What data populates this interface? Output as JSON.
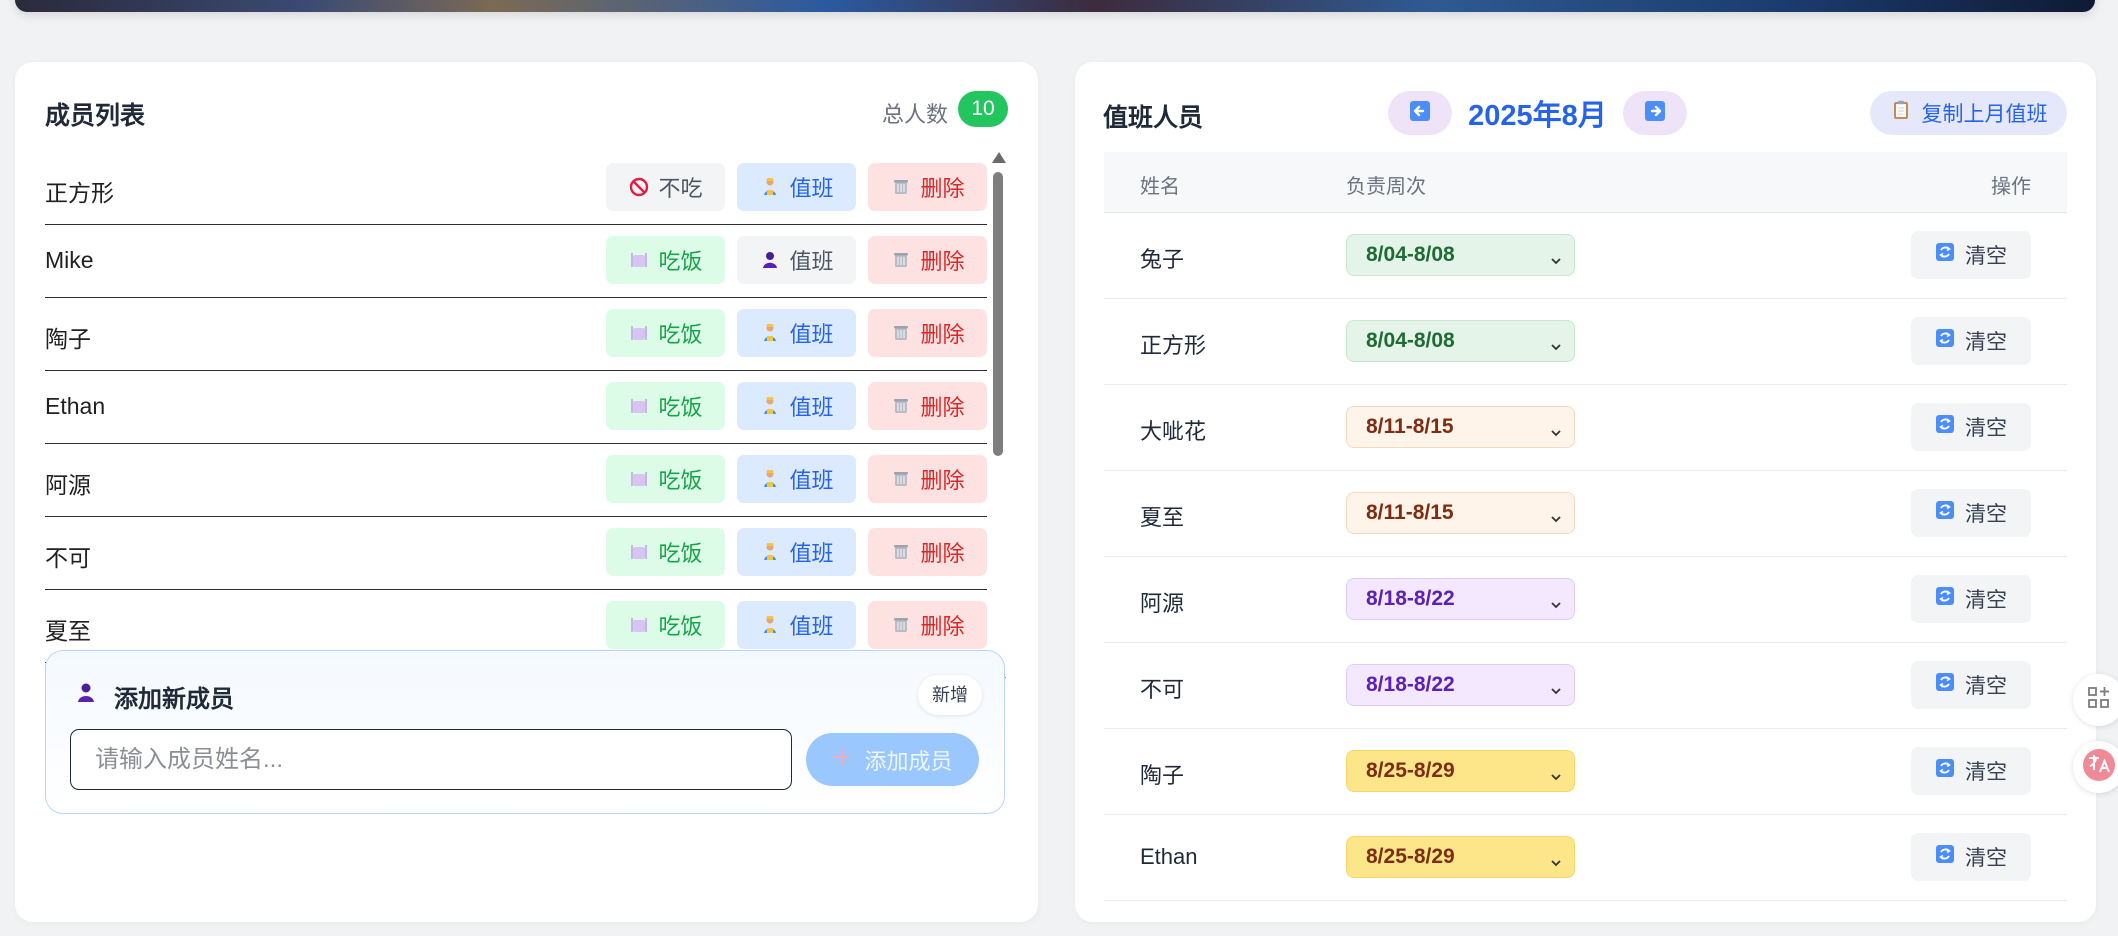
{
  "left_panel": {
    "title": "成员列表",
    "total_label": "总人数",
    "total_count": "10",
    "members": [
      {
        "name": "正方形",
        "eat_label": "不吃",
        "eat_state": "no",
        "duty_label": "值班",
        "duty_state": "active",
        "delete_label": "删除"
      },
      {
        "name": "Mike",
        "eat_label": "吃饭",
        "eat_state": "yes",
        "duty_label": "值班",
        "duty_state": "neutral",
        "delete_label": "删除"
      },
      {
        "name": "陶子",
        "eat_label": "吃饭",
        "eat_state": "yes",
        "duty_label": "值班",
        "duty_state": "active",
        "delete_label": "删除"
      },
      {
        "name": "Ethan",
        "eat_label": "吃饭",
        "eat_state": "yes",
        "duty_label": "值班",
        "duty_state": "active",
        "delete_label": "删除"
      },
      {
        "name": "阿源",
        "eat_label": "吃饭",
        "eat_state": "yes",
        "duty_label": "值班",
        "duty_state": "active",
        "delete_label": "删除"
      },
      {
        "name": "不可",
        "eat_label": "吃饭",
        "eat_state": "yes",
        "duty_label": "值班",
        "duty_state": "active",
        "delete_label": "删除"
      },
      {
        "name": "夏至",
        "eat_label": "吃饭",
        "eat_state": "yes",
        "duty_label": "值班",
        "duty_state": "active",
        "delete_label": "删除"
      }
    ],
    "add_member": {
      "title": "添加新成员",
      "badge": "新增",
      "placeholder": "请输入成员姓名...",
      "value": "",
      "button_label": "添加成员"
    }
  },
  "right_panel": {
    "title": "值班人员",
    "month_label": "2025年8月",
    "copy_button_label": "复制上月值班",
    "table": {
      "columns": [
        "姓名",
        "负责周次",
        "操作"
      ],
      "rows": [
        {
          "name": "兔子",
          "week": "8/04-8/08",
          "tone": "green",
          "action_label": "清空"
        },
        {
          "name": "正方形",
          "week": "8/04-8/08",
          "tone": "green",
          "action_label": "清空"
        },
        {
          "name": "大呲花",
          "week": "8/11-8/15",
          "tone": "orange",
          "action_label": "清空"
        },
        {
          "name": "夏至",
          "week": "8/11-8/15",
          "tone": "orange",
          "action_label": "清空"
        },
        {
          "name": "阿源",
          "week": "8/18-8/22",
          "tone": "purple",
          "action_label": "清空"
        },
        {
          "name": "不可",
          "week": "8/18-8/22",
          "tone": "purple",
          "action_label": "清空"
        },
        {
          "name": "陶子",
          "week": "8/25-8/29",
          "tone": "yellow",
          "action_label": "清空"
        },
        {
          "name": "Ethan",
          "week": "8/25-8/29",
          "tone": "yellow",
          "action_label": "清空"
        }
      ]
    }
  },
  "floating_widgets": [
    "apps-icon",
    "translate-icon"
  ],
  "colors": {
    "page_background": "#f1f2f4",
    "count_badge": "#22c55e",
    "primary_blue": "#2563eb",
    "eat_green": "#16a34a",
    "delete_red": "#dc2626",
    "week_green": "#e4f4e8",
    "week_orange": "#fff4ea",
    "week_purple": "#f3e8ff",
    "week_yellow": "#fde68a"
  }
}
